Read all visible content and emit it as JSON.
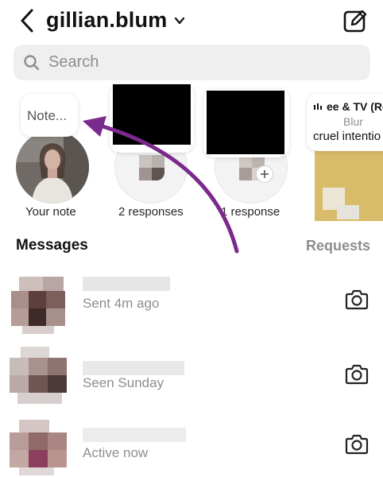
{
  "header": {
    "username": "gillian.blum",
    "back_icon": "chevron-left-icon",
    "dropdown_icon": "chevron-down-icon",
    "compose_icon": "new-message-icon"
  },
  "search": {
    "placeholder": "Search",
    "value": ""
  },
  "notes": [
    {
      "bubble": "Note...",
      "label": "Your note"
    },
    {
      "label": "2 responses"
    },
    {
      "label": "1 response"
    },
    {
      "music_title": "ee & TV (Re",
      "music_artist": "Blur",
      "music_caption": "cruel intentio"
    }
  ],
  "messages_section": {
    "title": "Messages",
    "requests_label": "Requests"
  },
  "conversations": [
    {
      "status": "Sent 4m ago"
    },
    {
      "status": "Seen Sunday"
    },
    {
      "status": "Active now"
    }
  ],
  "colors": {
    "annotation_arrow": "#7a2a8c",
    "secondary_text": "#8e8e8e",
    "search_bg": "#efefef"
  }
}
